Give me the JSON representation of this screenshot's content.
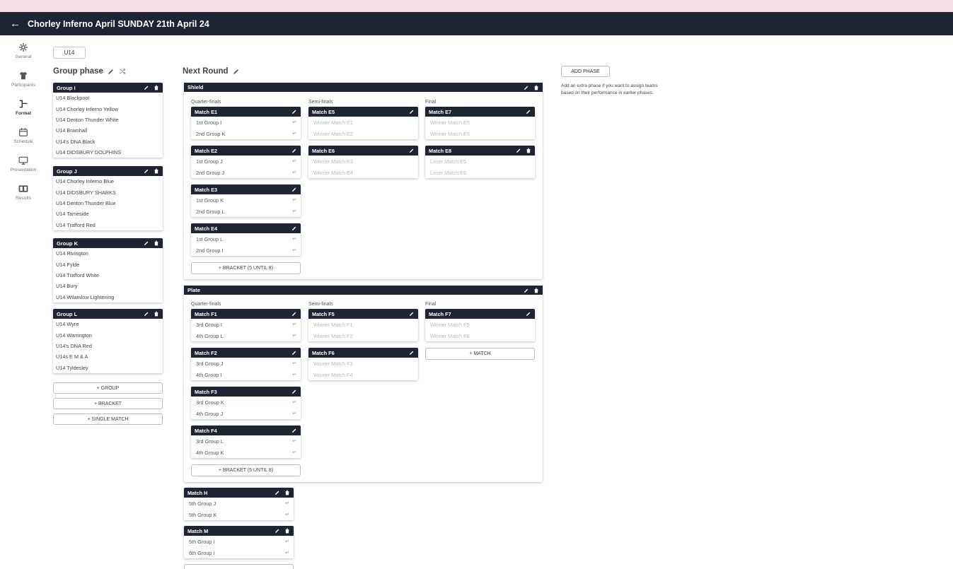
{
  "header": {
    "back_icon": "arrow-left-icon",
    "title": "Chorley Inferno April SUNDAY 21th April 24"
  },
  "nav": [
    {
      "label": "General",
      "icon": "gear-icon"
    },
    {
      "label": "Participants",
      "icon": "shirt-icon"
    },
    {
      "label": "Format",
      "icon": "bracket-icon"
    },
    {
      "label": "Schedule",
      "icon": "calendar-icon"
    },
    {
      "label": "Presentation",
      "icon": "monitor-icon"
    },
    {
      "label": "Results",
      "icon": "scoreboard-icon"
    }
  ],
  "category_tab": "U14",
  "group_phase": {
    "title": "Group phase",
    "groups": [
      {
        "name": "Group I",
        "teams": [
          "U14 Blackpool",
          "U14 Chorley Inferno Yellow",
          "U14 Denton Thunder White",
          "U14 Bramhall",
          "U14's DNA Black",
          "U14 DIDSBURY DOLPHINS"
        ]
      },
      {
        "name": "Group J",
        "teams": [
          "U14 Chorley Inferno Blue",
          "U14 DIDSBURY SHARKS",
          "U14 Denton Thunder Blue",
          "U14 Tameside",
          "U14 Trafford Red"
        ]
      },
      {
        "name": "Group K",
        "teams": [
          "U14 Rivington",
          "U14 Fylde",
          "U14 Trafford White",
          "U14 Bury",
          "U14 Wilamlow Lightening"
        ]
      },
      {
        "name": "Group L",
        "teams": [
          "U14 Wyre",
          "U14 Warrington",
          "U14's DNA Red",
          "U14s E M & A",
          "U14 Tyldesley"
        ]
      }
    ],
    "buttons": {
      "group": "+ GROUP",
      "bracket": "+ BRACKET",
      "single_match": "+ SINGLE MATCH"
    }
  },
  "next_round": {
    "title": "Next Round",
    "shield": {
      "name": "Shield",
      "rounds": [
        "Quarter-finals",
        "Semi-finals",
        "Final"
      ],
      "quarter": [
        {
          "name": "Match E1",
          "rows": [
            "1st Group I",
            "2nd Group K"
          ]
        },
        {
          "name": "Match E2",
          "rows": [
            "1st Group J",
            "2nd Group J"
          ]
        },
        {
          "name": "Match E3",
          "rows": [
            "1st Group K",
            "2nd Group L"
          ]
        },
        {
          "name": "Match E4",
          "rows": [
            "1st Group L",
            "2nd Group I"
          ]
        }
      ],
      "semi": [
        {
          "name": "Match E5",
          "rows": [
            "Winner Match E1",
            "Winner Match E2"
          ]
        },
        {
          "name": "Match E6",
          "rows": [
            "Winner Match E3",
            "Winner Match E4"
          ]
        }
      ],
      "final": [
        {
          "name": "Match E7",
          "rows": [
            "Winner Match E5",
            "Winner Match E6"
          ]
        },
        {
          "name": "Match E8",
          "rows": [
            "Loser Match E5",
            "Loser Match E6"
          ]
        }
      ],
      "bracket_button": "+ BRACKET (5 UNTIL 8)"
    },
    "plate": {
      "name": "Plate",
      "rounds": [
        "Quarter-finals",
        "Semi-finals",
        "Final"
      ],
      "quarter": [
        {
          "name": "Match F1",
          "rows": [
            "3rd Group I",
            "4th Group L"
          ]
        },
        {
          "name": "Match F2",
          "rows": [
            "3rd Group J",
            "4th Group I"
          ]
        },
        {
          "name": "Match F3",
          "rows": [
            "3rd Group K",
            "4th Group J"
          ]
        },
        {
          "name": "Match F4",
          "rows": [
            "3rd Group L",
            "4th Group K"
          ]
        }
      ],
      "semi": [
        {
          "name": "Match F5",
          "rows": [
            "Winner Match F1",
            "Winner Match F2"
          ]
        },
        {
          "name": "Match F6",
          "rows": [
            "Winner Match F3",
            "Winner Match F4"
          ]
        }
      ],
      "final": [
        {
          "name": "Match F7",
          "rows": [
            "Winner Match F5",
            "Winner Match F6"
          ]
        }
      ],
      "match_button": "+ MATCH",
      "bracket_button": "+ BRACKET (5 UNTIL 8)"
    },
    "single_matches": [
      {
        "name": "Match H",
        "rows": [
          "5th Group J",
          "5th Group K"
        ]
      },
      {
        "name": "Match M",
        "rows": [
          "5th Group I",
          "6th Group I"
        ]
      }
    ]
  },
  "add_phase": {
    "button": "ADD PHASE",
    "help": "Add an extra phase if you want to assign teams based on their performance in earlier phases."
  }
}
